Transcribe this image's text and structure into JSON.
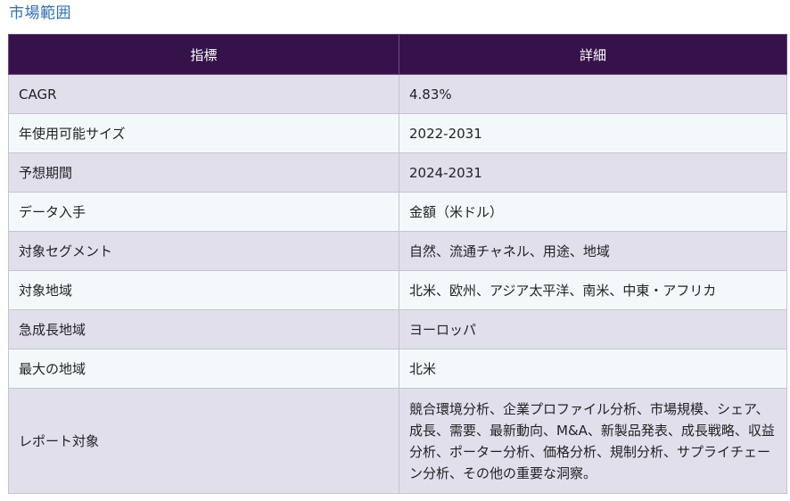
{
  "heading": "市場範囲",
  "table": {
    "headers": [
      "指標",
      "詳細"
    ],
    "rows": [
      {
        "k": "CAGR",
        "v": "4.83%"
      },
      {
        "k": "年使用可能サイズ",
        "v": "2022-2031"
      },
      {
        "k": "予想期間",
        "v": "2024-2031"
      },
      {
        "k": "データ入手",
        "v": "金額（米ドル）"
      },
      {
        "k": "対象セグメント",
        "v": "自然、流通チャネル、用途、地域"
      },
      {
        "k": "対象地域",
        "v": "北米、欧州、アジア太平洋、南米、中東・アフリカ"
      },
      {
        "k": "急成長地域",
        "v": "ヨーロッパ"
      },
      {
        "k": "最大の地域",
        "v": "北米"
      },
      {
        "k": "レポート対象",
        "v": "競合環境分析、企業プロファイル分析、市場規模、シェア、成長、需要、最新動向、M&A、新製品発表、成長戦略、収益分析、ポーター分析、価格分析、規制分析、サプライチェーン分析、その他の重要な洞察。"
      }
    ]
  }
}
